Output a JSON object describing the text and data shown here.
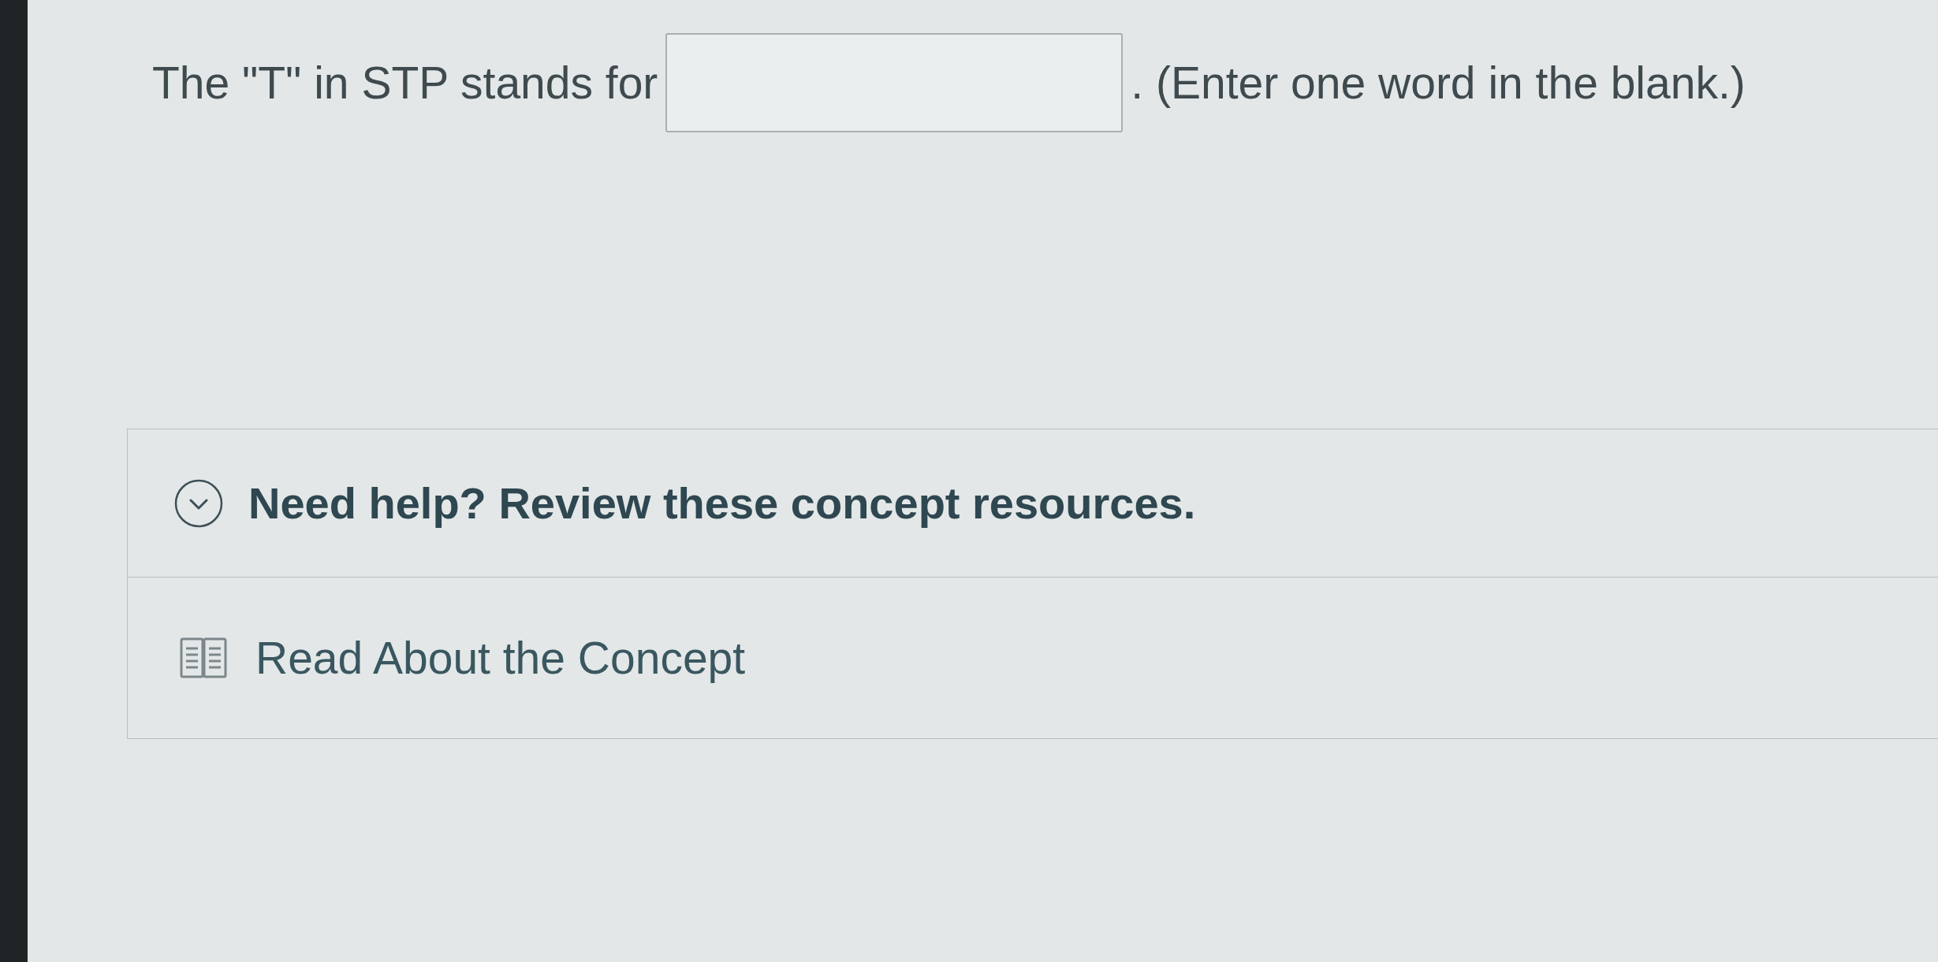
{
  "question": {
    "parts": [
      {
        "kind": "text",
        "text": "The \"T\" in STP stands for"
      },
      {
        "kind": "blank"
      },
      {
        "kind": "text",
        "text": ". (Enter one word in the blank.)"
      }
    ]
  },
  "help_panel": {
    "title": "Need help? Review these concept resources.",
    "expanded": true,
    "resources": [
      {
        "kind": "reading",
        "label": "Read About the Concept"
      }
    ]
  }
}
